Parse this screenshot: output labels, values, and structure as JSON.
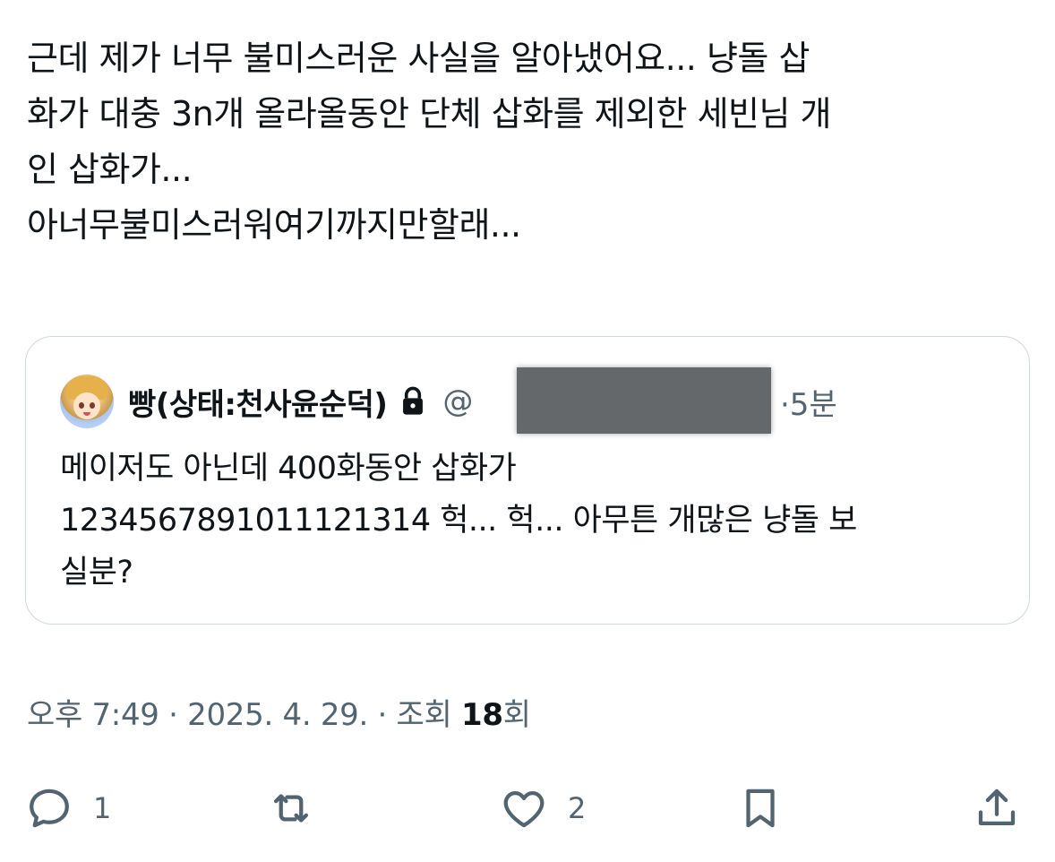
{
  "tweet": {
    "text_lines": [
      "근데 제가 너무 불미스러운 사실을 알아냈어요... 냥돌 삽",
      "화가 대충 3n개 올라올동안 단체 삽화를 제외한 세빈님 개",
      "인 삽화가...",
      "아너무불미스러워여기까지만할래..."
    ]
  },
  "quote": {
    "display_name": "빵(상태:천사윤순덕)",
    "handle_prefix": "@",
    "time": "·5분",
    "body_lines": [
      "메이저도 아닌데 400화동안 삽화가",
      "1234567891011121314 헉... 헉... 아무튼 개많은 냥돌 보",
      "실분?"
    ]
  },
  "meta": {
    "time_date": "오후 7:49 · 2025. 4. 29. · 조회 ",
    "views": "18",
    "views_suffix": "회"
  },
  "actions": {
    "reply": {
      "icon": "reply-icon",
      "count": "1"
    },
    "retweet": {
      "icon": "retweet-icon"
    },
    "like": {
      "icon": "heart-icon",
      "count": "2"
    },
    "bookmark": {
      "icon": "bookmark-icon"
    },
    "share": {
      "icon": "share-icon"
    }
  },
  "colors": {
    "text": "#0f1419",
    "secondary": "#536471",
    "border": "#cfd9de"
  }
}
